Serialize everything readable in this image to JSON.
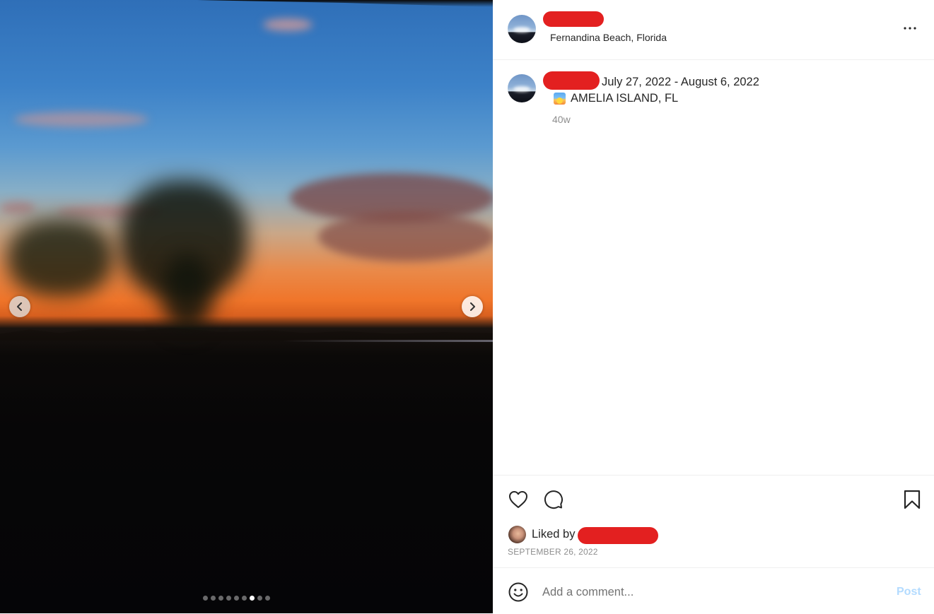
{
  "post": {
    "location": "Fernandina Beach, Florida",
    "caption_dates": "July 27, 2022 - August 6, 2022",
    "caption_place": "AMELIA ISLAND, FL",
    "caption_emoji": "sunrise-emoji",
    "time_ago": "40w",
    "liked_by_label": "Liked by",
    "date": "SEPTEMBER 26, 2022"
  },
  "carousel": {
    "total_slides": 9,
    "active_slide": 7
  },
  "comment": {
    "placeholder": "Add a comment...",
    "post_label": "Post"
  },
  "icons": {
    "more": "more-options-icon",
    "like": "heart-icon",
    "comment": "comment-icon",
    "save": "bookmark-icon",
    "emoji": "emoji-icon",
    "prev": "chevron-left-icon",
    "next": "chevron-right-icon"
  },
  "colors": {
    "redaction": "#e32020",
    "post_button": "#b3dbff",
    "secondary_text": "#8e8e8e"
  }
}
